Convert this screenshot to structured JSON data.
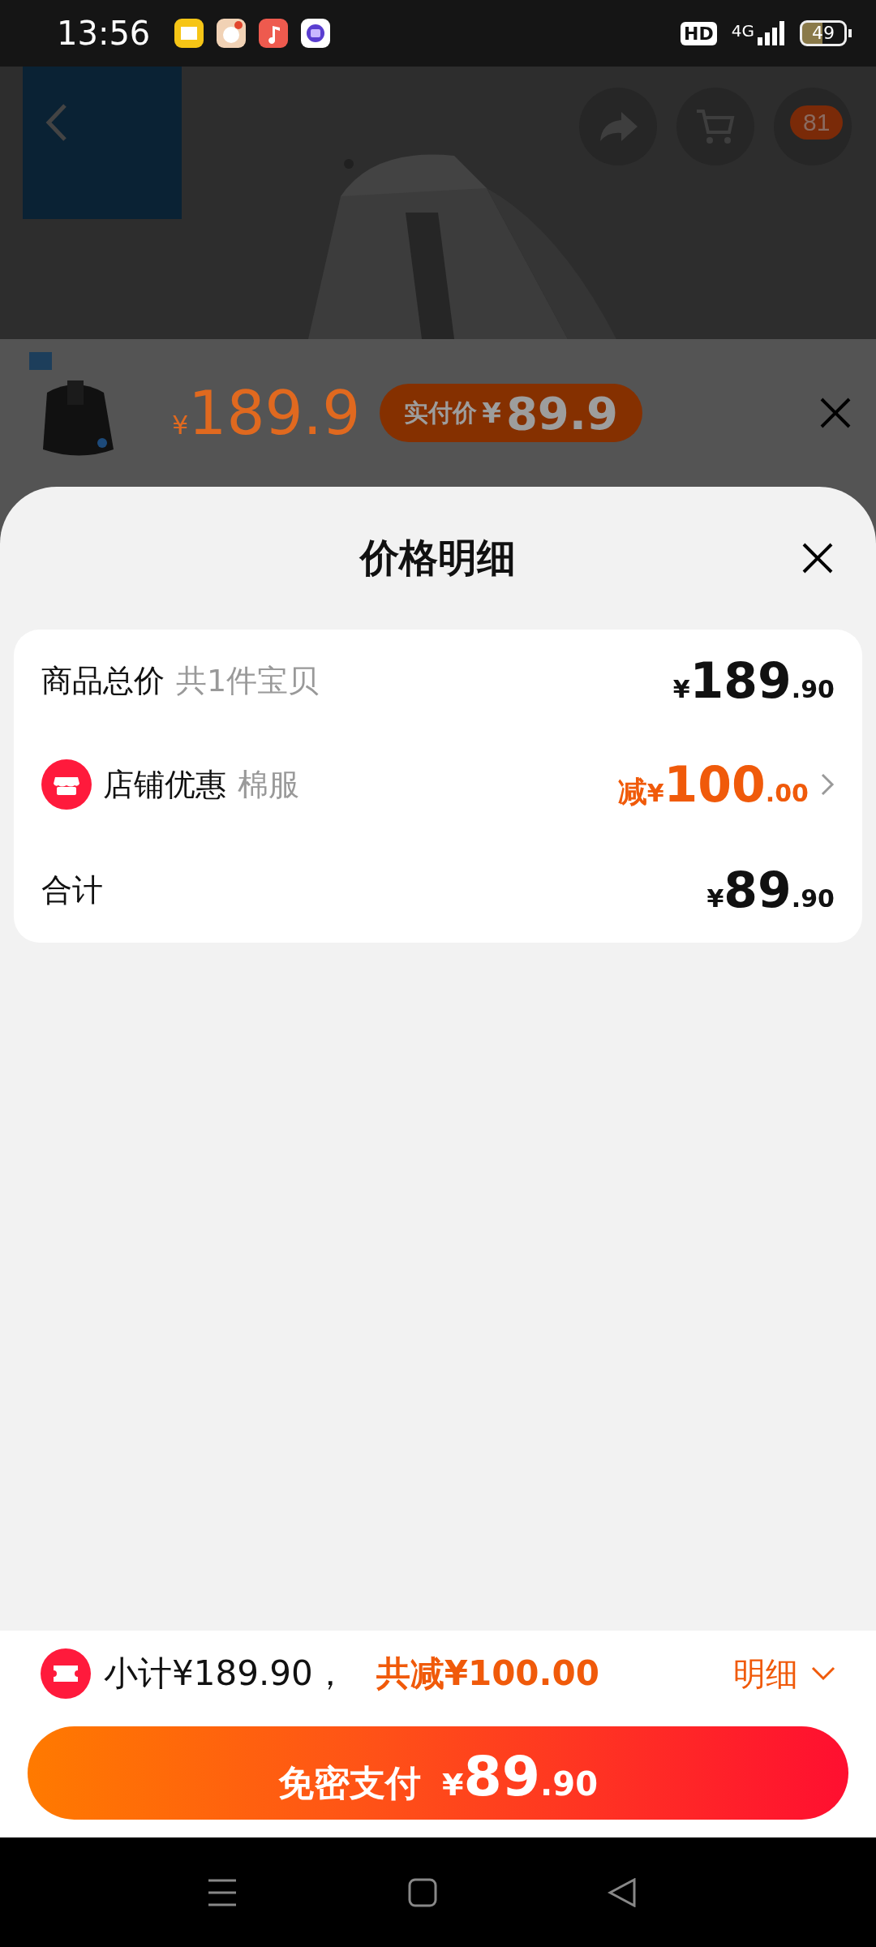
{
  "status_bar": {
    "time": "13:56",
    "hd": "HD",
    "network": "4G",
    "battery": "49"
  },
  "product_page": {
    "kind": "picture",
    "cart_badge": "81"
  },
  "product_strip": {
    "price": {
      "currency": "¥",
      "amount": "189.9"
    },
    "pay_price": {
      "label": "实付价",
      "currency": "¥",
      "amount": "89.9"
    }
  },
  "sheet": {
    "title": "价格明细",
    "rows": [
      {
        "kind": "total",
        "label": "商品总价",
        "note": "共1件宝贝",
        "currency": "¥",
        "integer": "189",
        "fraction": ".90"
      },
      {
        "kind": "discount",
        "label": "店铺优惠",
        "note": "棉服",
        "prefix": "减",
        "currency": "¥",
        "integer": "100",
        "fraction": ".00"
      },
      {
        "kind": "sum",
        "label": "合计",
        "currency": "¥",
        "integer": "89",
        "fraction": ".90"
      }
    ]
  },
  "footer": {
    "subtotal": "小计¥189.90，",
    "saving": "共减¥100.00",
    "details": "明细",
    "pay_button": {
      "label": "免密支付",
      "currency": "¥",
      "integer": "89",
      "fraction": ".90"
    }
  }
}
